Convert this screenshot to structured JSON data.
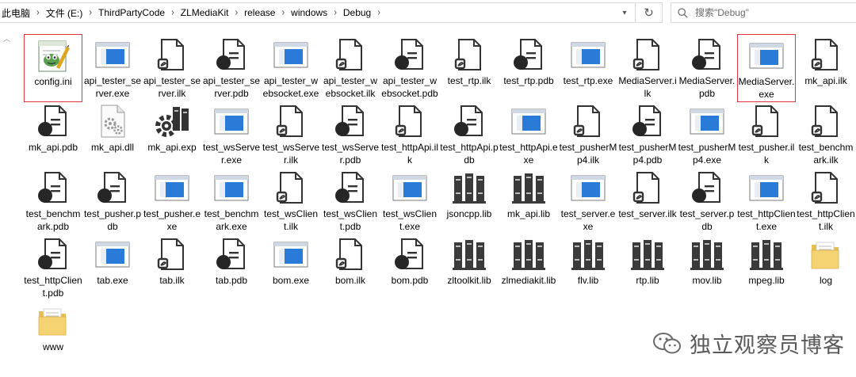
{
  "address": {
    "crumbs": [
      "此电脑",
      "文件 (E:)",
      "ThirdPartyCode",
      "ZLMediaKit",
      "release",
      "windows",
      "Debug"
    ],
    "search_placeholder": "搜索\"Debug\""
  },
  "files": [
    {
      "label": "config.ini",
      "icon": "ini",
      "highlighted": true
    },
    {
      "label": "api_tester_server.exe",
      "icon": "exe"
    },
    {
      "label": "api_tester_server.ilk",
      "icon": "ilk"
    },
    {
      "label": "api_tester_server.pdb",
      "icon": "pdb"
    },
    {
      "label": "api_tester_websocket.exe",
      "icon": "exe"
    },
    {
      "label": "api_tester_websocket.ilk",
      "icon": "ilk"
    },
    {
      "label": "api_tester_websocket.pdb",
      "icon": "pdb"
    },
    {
      "label": "test_rtp.ilk",
      "icon": "ilk"
    },
    {
      "label": "test_rtp.pdb",
      "icon": "pdb"
    },
    {
      "label": "test_rtp.exe",
      "icon": "exe"
    },
    {
      "label": "MediaServer.ilk",
      "icon": "ilk"
    },
    {
      "label": "MediaServer.pdb",
      "icon": "pdb"
    },
    {
      "label": "MediaServer.exe",
      "icon": "exe",
      "highlighted": true
    },
    {
      "label": "mk_api.ilk",
      "icon": "ilk"
    },
    {
      "label": "mk_api.pdb",
      "icon": "pdb"
    },
    {
      "label": "mk_api.dll",
      "icon": "dll"
    },
    {
      "label": "mk_api.exp",
      "icon": "exp"
    },
    {
      "label": "test_wsServer.exe",
      "icon": "exe"
    },
    {
      "label": "test_wsServer.ilk",
      "icon": "ilk"
    },
    {
      "label": "test_wsServer.pdb",
      "icon": "pdb"
    },
    {
      "label": "test_httpApi.ilk",
      "icon": "ilk"
    },
    {
      "label": "test_httpApi.pdb",
      "icon": "pdb"
    },
    {
      "label": "test_httpApi.exe",
      "icon": "exe"
    },
    {
      "label": "test_pusherMp4.ilk",
      "icon": "ilk"
    },
    {
      "label": "test_pusherMp4.pdb",
      "icon": "pdb"
    },
    {
      "label": "test_pusherMp4.exe",
      "icon": "exe"
    },
    {
      "label": "test_pusher.ilk",
      "icon": "ilk"
    },
    {
      "label": "test_benchmark.ilk",
      "icon": "ilk"
    },
    {
      "label": "test_benchmark.pdb",
      "icon": "pdb"
    },
    {
      "label": "test_pusher.pdb",
      "icon": "pdb"
    },
    {
      "label": "test_pusher.exe",
      "icon": "exe"
    },
    {
      "label": "test_benchmark.exe",
      "icon": "exe"
    },
    {
      "label": "test_wsClient.ilk",
      "icon": "ilk"
    },
    {
      "label": "test_wsClient.pdb",
      "icon": "pdb"
    },
    {
      "label": "test_wsClient.exe",
      "icon": "exe"
    },
    {
      "label": "jsoncpp.lib",
      "icon": "lib"
    },
    {
      "label": "mk_api.lib",
      "icon": "lib"
    },
    {
      "label": "test_server.exe",
      "icon": "exe"
    },
    {
      "label": "test_server.ilk",
      "icon": "ilk"
    },
    {
      "label": "test_server.pdb",
      "icon": "pdb"
    },
    {
      "label": "test_httpClient.exe",
      "icon": "exe"
    },
    {
      "label": "test_httpClient.ilk",
      "icon": "ilk"
    },
    {
      "label": "test_httpClient.pdb",
      "icon": "pdb"
    },
    {
      "label": "tab.exe",
      "icon": "exe"
    },
    {
      "label": "tab.ilk",
      "icon": "ilk"
    },
    {
      "label": "tab.pdb",
      "icon": "pdb"
    },
    {
      "label": "bom.exe",
      "icon": "exe"
    },
    {
      "label": "bom.ilk",
      "icon": "ilk"
    },
    {
      "label": "bom.pdb",
      "icon": "pdb"
    },
    {
      "label": "zltoolkit.lib",
      "icon": "lib"
    },
    {
      "label": "zlmediakit.lib",
      "icon": "lib"
    },
    {
      "label": "flv.lib",
      "icon": "lib"
    },
    {
      "label": "rtp.lib",
      "icon": "lib"
    },
    {
      "label": "mov.lib",
      "icon": "lib"
    },
    {
      "label": "mpeg.lib",
      "icon": "lib"
    },
    {
      "label": "log",
      "icon": "folder"
    },
    {
      "label": "www",
      "icon": "folder"
    }
  ],
  "watermark": {
    "text": "独立观察员博客"
  }
}
